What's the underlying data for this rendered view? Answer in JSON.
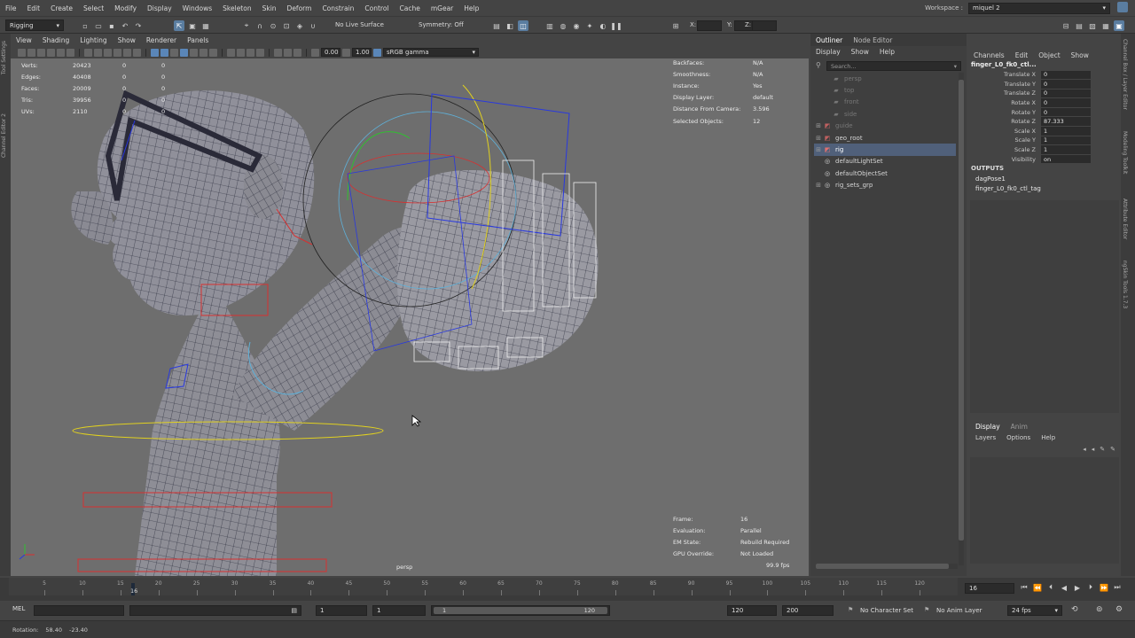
{
  "menubar": {
    "items": [
      "File",
      "Edit",
      "Create",
      "Select",
      "Modify",
      "Display",
      "Windows",
      "Skeleton",
      "Skin",
      "Deform",
      "Constrain",
      "Control",
      "Cache",
      "mGear",
      "Help"
    ],
    "workspace_label": "Workspace :",
    "workspace_value": "miquel 2"
  },
  "statusline": {
    "mode": "Rigging",
    "live_surface": "No Live Surface",
    "symmetry": "Symmetry: Off",
    "x_label": "X:",
    "y_label": "Y:",
    "z_label": "Z:"
  },
  "left_tabs": [
    "Tool Settings",
    "Channel Editor 2"
  ],
  "viewport": {
    "menus": [
      "View",
      "Shading",
      "Lighting",
      "Show",
      "Renderer",
      "Panels"
    ],
    "exposure": "0.00",
    "gamma": "1.00",
    "colorspace": "sRGB gamma",
    "camera_label": "persp",
    "fps": "99.9 fps",
    "poly_stats": [
      {
        "key": "Verts:",
        "a": "20423",
        "b": "0",
        "c": "0"
      },
      {
        "key": "Edges:",
        "a": "40408",
        "b": "0",
        "c": "0"
      },
      {
        "key": "Faces:",
        "a": "20009",
        "b": "0",
        "c": "0"
      },
      {
        "key": "Tris:",
        "a": "39956",
        "b": "0",
        "c": "0"
      },
      {
        "key": "UVs:",
        "a": "2110",
        "b": "0",
        "c": "0"
      }
    ],
    "hud_right": [
      {
        "key": "Backfaces:",
        "val": "N/A"
      },
      {
        "key": "Smoothness:",
        "val": "N/A"
      },
      {
        "key": "Instance:",
        "val": "Yes"
      },
      {
        "key": "Display Layer:",
        "val": "default"
      },
      {
        "key": "Distance From Camera:",
        "val": "3.596"
      },
      {
        "key": "Selected Objects:",
        "val": "12"
      }
    ],
    "hud_bottom": [
      {
        "key": "Frame:",
        "val": "16"
      },
      {
        "key": "Evaluation:",
        "val": "Parallel"
      },
      {
        "key": "EM State:",
        "val": "Rebuild Required"
      },
      {
        "key": "GPU Override:",
        "val": "Not Loaded"
      }
    ]
  },
  "outliner": {
    "tabs": [
      "Outliner",
      "Node Editor"
    ],
    "menus": [
      "Display",
      "Show",
      "Help"
    ],
    "search_placeholder": "Search...",
    "items": [
      {
        "label": "persp",
        "dim": true,
        "exp": "",
        "icon": "camera-icon"
      },
      {
        "label": "top",
        "dim": true,
        "exp": "",
        "icon": "camera-icon"
      },
      {
        "label": "front",
        "dim": true,
        "exp": "",
        "icon": "camera-icon"
      },
      {
        "label": "side",
        "dim": true,
        "exp": "",
        "icon": "camera-icon"
      },
      {
        "label": "guide",
        "dim": true,
        "exp": "⊞",
        "icon": "transform-icon"
      },
      {
        "label": "geo_root",
        "dim": false,
        "exp": "⊞",
        "icon": "transform-icon"
      },
      {
        "label": "rig",
        "dim": false,
        "exp": "⊞",
        "icon": "transform-icon",
        "selected": true
      },
      {
        "label": "defaultLightSet",
        "dim": false,
        "exp": "",
        "icon": "set-icon"
      },
      {
        "label": "defaultObjectSet",
        "dim": false,
        "exp": "",
        "icon": "set-icon"
      },
      {
        "label": "rig_sets_grp",
        "dim": false,
        "exp": "⊞",
        "icon": "set-icon"
      }
    ]
  },
  "channelbox": {
    "menus": [
      "Channels",
      "Edit",
      "Object",
      "Show"
    ],
    "node_name": "finger_L0_fk0_ctl...",
    "attributes": [
      {
        "name": "Translate X",
        "value": "0"
      },
      {
        "name": "Translate Y",
        "value": "0"
      },
      {
        "name": "Translate Z",
        "value": "0"
      },
      {
        "name": "Rotate X",
        "value": "0"
      },
      {
        "name": "Rotate Y",
        "value": "0"
      },
      {
        "name": "Rotate Z",
        "value": "87.333"
      },
      {
        "name": "Scale X",
        "value": "1"
      },
      {
        "name": "Scale Y",
        "value": "1"
      },
      {
        "name": "Scale Z",
        "value": "1"
      },
      {
        "name": "Visibility",
        "value": "on"
      }
    ],
    "outputs_label": "OUTPUTS",
    "outputs": [
      "dagPose1",
      "finger_L0_fk0_ctl_tag"
    ],
    "layer_tabs": [
      "Display",
      "Anim"
    ],
    "layer_menus": [
      "Layers",
      "Options",
      "Help"
    ]
  },
  "right_tabs": [
    "Channel Box / Layer Editor",
    "Modeling Toolkit",
    "Attribute Editor",
    "ngSkin Tools 1.7.3"
  ],
  "timeslider": {
    "ticks": [
      "5",
      "10",
      "15",
      "20",
      "25",
      "30",
      "35",
      "40",
      "45",
      "50",
      "55",
      "60",
      "65",
      "70",
      "75",
      "80",
      "85",
      "90",
      "95",
      "100",
      "105",
      "110",
      "115",
      "120"
    ],
    "current_frame": "16",
    "current_frame_field": "16"
  },
  "rangebar": {
    "mel": "MEL",
    "start": "1",
    "range_start": "1",
    "slider_start": "1",
    "slider_end": "120",
    "range_end": "120",
    "end": "200",
    "character_set": "No Character Set",
    "anim_layer": "No Anim Layer",
    "fps": "24 fps"
  },
  "helpline": {
    "label": "Rotation:",
    "v1": "58.40",
    "v2": "-23.40"
  }
}
